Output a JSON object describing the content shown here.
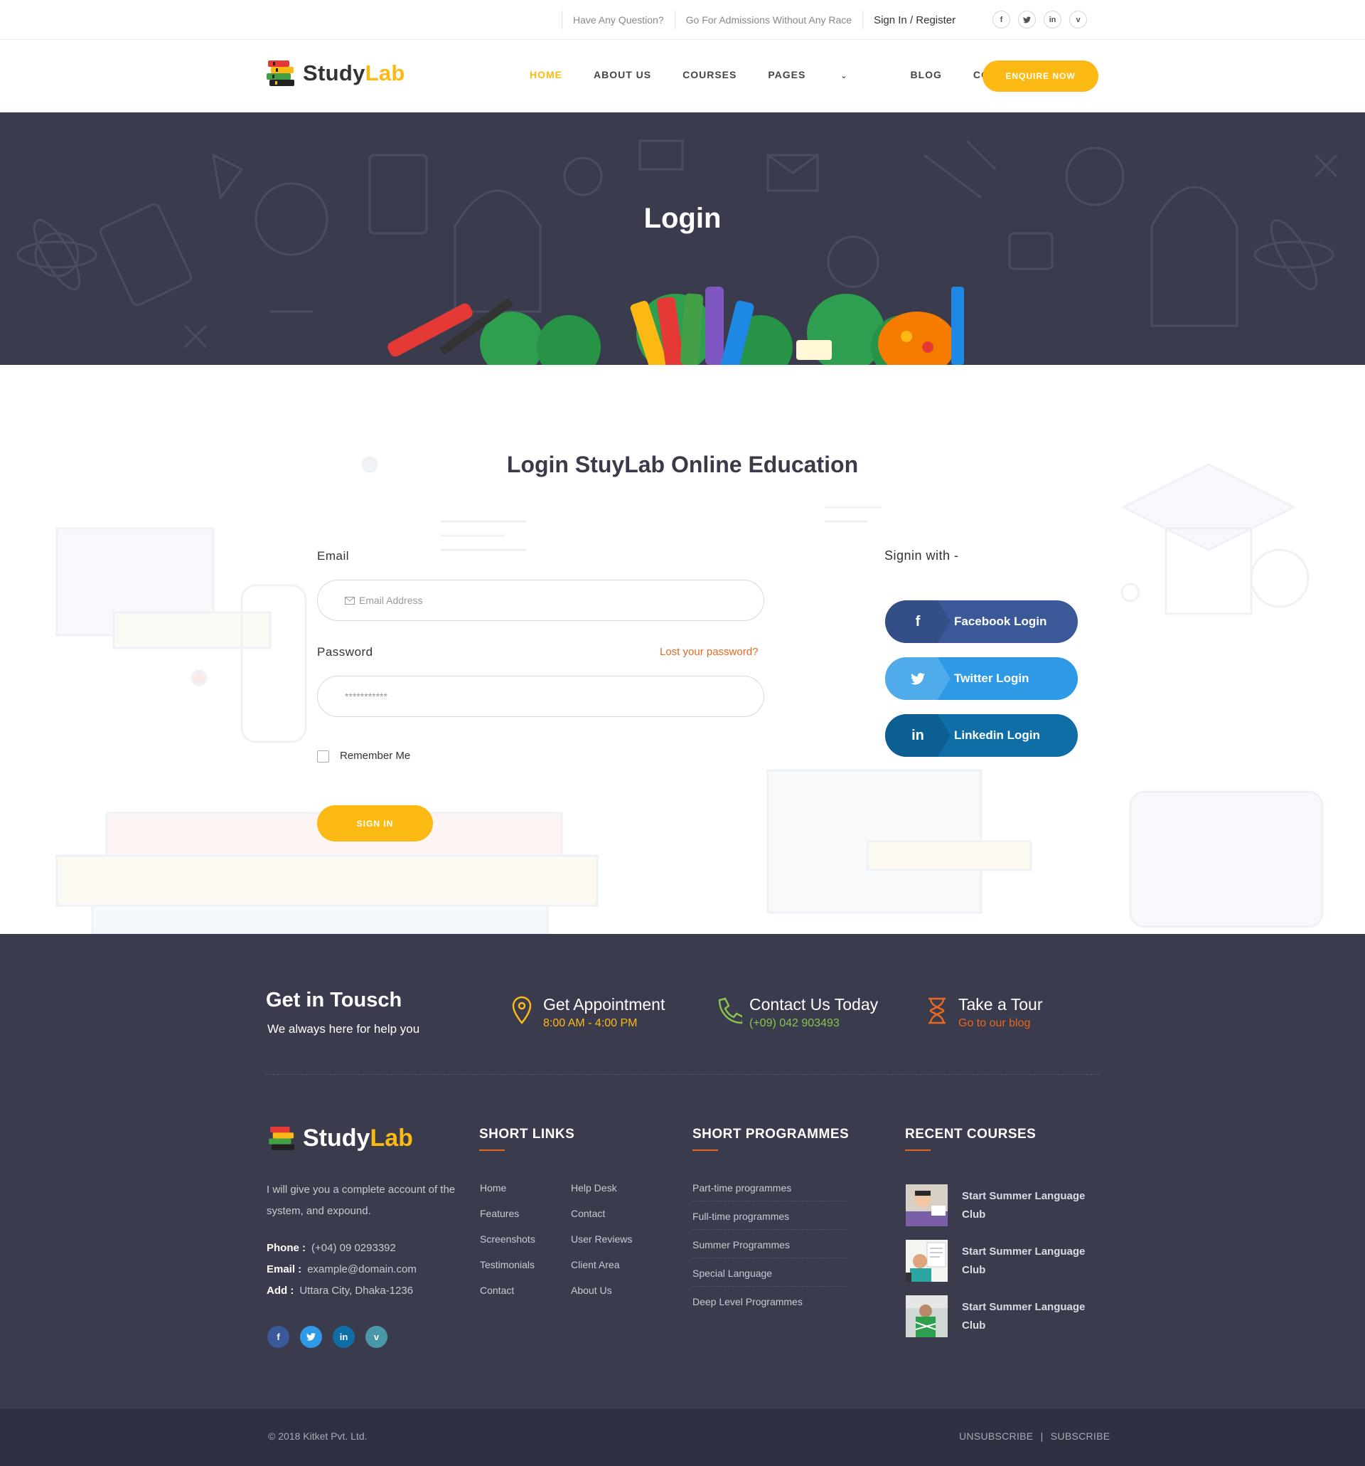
{
  "topbar": {
    "question": "Have Any Question?",
    "admissions": "Go For Admissions Without Any Race",
    "signin_register": "Sign In / Register",
    "socials": [
      "f",
      "t",
      "in",
      "v"
    ]
  },
  "brand": {
    "name_part1": "Study",
    "name_part2": "Lab",
    "accent_color": "#fdb913"
  },
  "nav": {
    "items": [
      "HOME",
      "ABOUT US",
      "COURSES",
      "PAGES",
      "BLOG",
      "CONTACT"
    ],
    "active": "HOME",
    "pages_chevron": "⌄",
    "enquire": "ENQUIRE NOW"
  },
  "banner": {
    "title": "Login"
  },
  "login": {
    "heading": "Login StuyLab Online Education",
    "email_label": "Email",
    "email_placeholder": "Email Address",
    "password_label": "Password",
    "password_placeholder": "***********",
    "lost_password": "Lost your password?",
    "remember": "Remember Me",
    "signin": "SIGN IN",
    "signin_with": "Signin with -",
    "facebook": "Facebook Login",
    "twitter": "Twitter Login",
    "linkedin": "Linkedin Login"
  },
  "footer": {
    "touch_title": "Get in Tousch",
    "touch_sub": "We always here for help you",
    "appointment": {
      "title": "Get Appointment",
      "value": "8:00 AM - 4:00 PM",
      "icon": "map-pin-icon"
    },
    "contact": {
      "title": "Contact Us Today",
      "value": "(+09) 042 903493",
      "icon": "phone-icon"
    },
    "tour": {
      "title": "Take a Tour",
      "value": "Go to our blog",
      "icon": "hourglass-icon"
    },
    "about": "I will give you a complete account of the system, and expound.",
    "phone_label": "Phone :",
    "phone": "(+04) 09 0293392",
    "email_label": "Email :",
    "email": "example@domain.com",
    "add_label": "Add :",
    "add": "Uttara City, Dhaka-1236",
    "short_links_title": "SHORT LINKS",
    "short_links_col1": [
      "Home",
      "Features",
      "Screenshots",
      "Testimonials",
      "Contact"
    ],
    "short_links_col2": [
      "Help Desk",
      "Contact",
      "User Reviews",
      "Client Area",
      "About Us"
    ],
    "programmes_title": "SHORT PROGRAMMES",
    "programmes": [
      "Part-time programmes",
      "Full-time programmes",
      "Summer Programmes",
      "Special Language",
      "Deep Level Programmes"
    ],
    "courses_title": "RECENT COURSES",
    "courses": [
      "Start Summer Language Club",
      "Start Summer Language Club",
      "Start Summer Language Club"
    ],
    "copyright": "© 2018 Kitket Pvt. Ltd.",
    "unsubscribe": "UNSUBSCRIBE",
    "separator": "|",
    "subscribe": "SUBSCRIBE"
  },
  "colors": {
    "dark": "#3a3c4e",
    "darker": "#2f3142",
    "orange": "#e8681f",
    "facebook": "#3b5998",
    "twitter": "#2e9ae6",
    "linkedin": "#0f6ea6"
  }
}
